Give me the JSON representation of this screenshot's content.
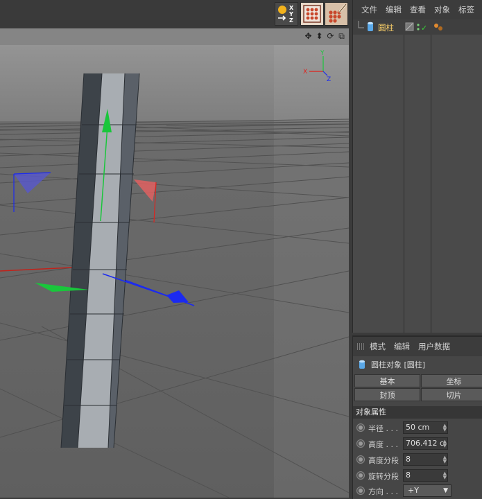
{
  "toolbar": {
    "buttons": [
      {
        "name": "coordinate-system",
        "glyph": "XYZ"
      },
      {
        "name": "render-view",
        "glyph": ""
      },
      {
        "name": "render-settings",
        "glyph": ""
      }
    ]
  },
  "viewport": {
    "axis_labels": {
      "x": "X",
      "y": "Y",
      "z": "Z"
    },
    "nav_icons": [
      "move-view-icon",
      "zoom-view-icon",
      "rotate-view-icon",
      "maximize-view-icon"
    ]
  },
  "object_manager": {
    "menu": [
      "文件",
      "编辑",
      "查看",
      "对象",
      "标签"
    ],
    "objects": [
      {
        "name": "圆柱",
        "icon": "cylinder-icon",
        "check": "✓"
      }
    ]
  },
  "attribute_manager": {
    "menu": [
      "模式",
      "编辑",
      "用户数据"
    ],
    "title": "圆柱对象 [圆柱]",
    "tabs": [
      "基本",
      "坐标",
      "封顶",
      "切片"
    ],
    "section": "对象属性",
    "params": [
      {
        "label": "半径 . . . ",
        "value": "50 cm",
        "type": "number"
      },
      {
        "label": "高度 . . . ",
        "value": "706.412 c",
        "type": "number"
      },
      {
        "label": "高度分段",
        "value": "8",
        "type": "number"
      },
      {
        "label": "旋转分段",
        "value": "8",
        "type": "number"
      },
      {
        "label": "方向 . . . ",
        "value": "+Y",
        "type": "select"
      }
    ]
  },
  "colors": {
    "x_axis": "#e0221d",
    "y_axis": "#19c63b",
    "z_axis": "#1b2af0",
    "selected_object": "#ffd36a"
  }
}
